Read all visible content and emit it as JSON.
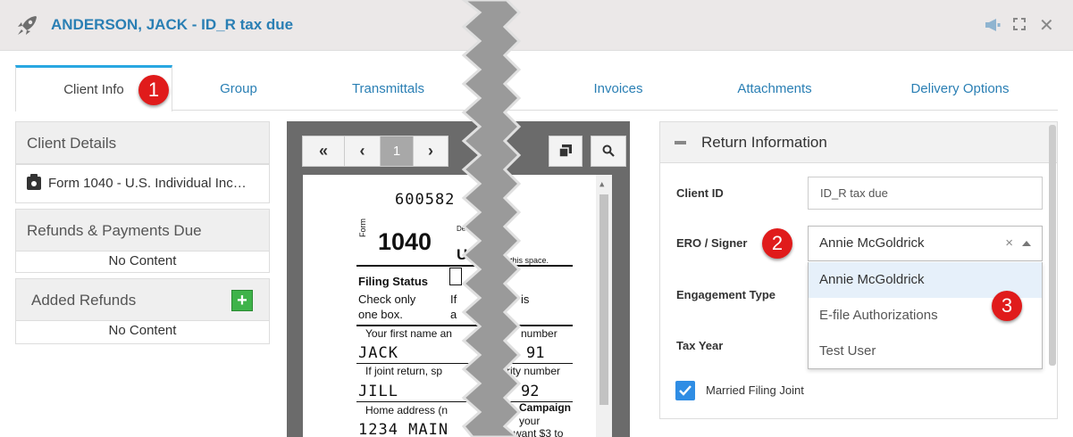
{
  "window": {
    "title": "ANDERSON, JACK - ID_R tax due",
    "icons": [
      "rocket-icon",
      "megaphone-icon",
      "expand-icon",
      "close-icon"
    ],
    "close_glyph": "✕"
  },
  "tabs": [
    {
      "label": "Client Info",
      "active": true
    },
    {
      "label": "Group"
    },
    {
      "label": "Transmittals"
    },
    {
      "label": "Invoices"
    },
    {
      "label": "Attachments"
    },
    {
      "label": "Delivery Options"
    }
  ],
  "badges": {
    "one": "1",
    "two": "2",
    "three": "3"
  },
  "left": {
    "client_details": {
      "title": "Client Details",
      "item": "Form 1040 - U.S. Individual Inc…"
    },
    "refunds_due": {
      "title": "Refunds & Payments Due",
      "empty": "No Content"
    },
    "added_refunds": {
      "title": "Added Refunds",
      "add": "+",
      "empty": "No Content"
    }
  },
  "viewer": {
    "first": "«",
    "prev": "‹",
    "page": "1",
    "next": "›",
    "doc": {
      "number": "600582",
      "form_word": "Form",
      "form_no": "1040",
      "dept": "De",
      "u": "U",
      "this_space": "this space.",
      "filing_status": "Filing Status",
      "check_only": "Check only",
      "one_box": "one box.",
      "if": "If",
      "is": "r is",
      "a": "a",
      "first_name": "Your first name an",
      "number_lbl": "number",
      "jack": "JACK",
      "n91": "91",
      "joint": "If joint return, sp",
      "sec_num": "rity number",
      "jill": "JILL",
      "n92": "92",
      "home": "Home address (n",
      "campaign": "Campaign",
      "main": "1234 MAIN",
      "your": "your",
      "want": "want $3 to"
    }
  },
  "return_info": {
    "title": "Return Information",
    "client_id_label": "Client ID",
    "client_id_value": "ID_R tax due",
    "ero_label": "ERO / Signer",
    "ero_value": "Annie McGoldrick",
    "clear": "×",
    "engagement_label": "Engagement Type",
    "tax_year_label": "Tax Year",
    "options": [
      "Annie McGoldrick",
      "E-file Authorizations",
      "Test User"
    ],
    "married_label": "Married Filing Joint",
    "married_checked": true
  },
  "colors": {
    "accent": "#2a7fb4",
    "badge": "#e01b1b",
    "tab_highlight": "#29a7e1",
    "add_green": "#3fb34a",
    "checkbox": "#2f8de4"
  }
}
